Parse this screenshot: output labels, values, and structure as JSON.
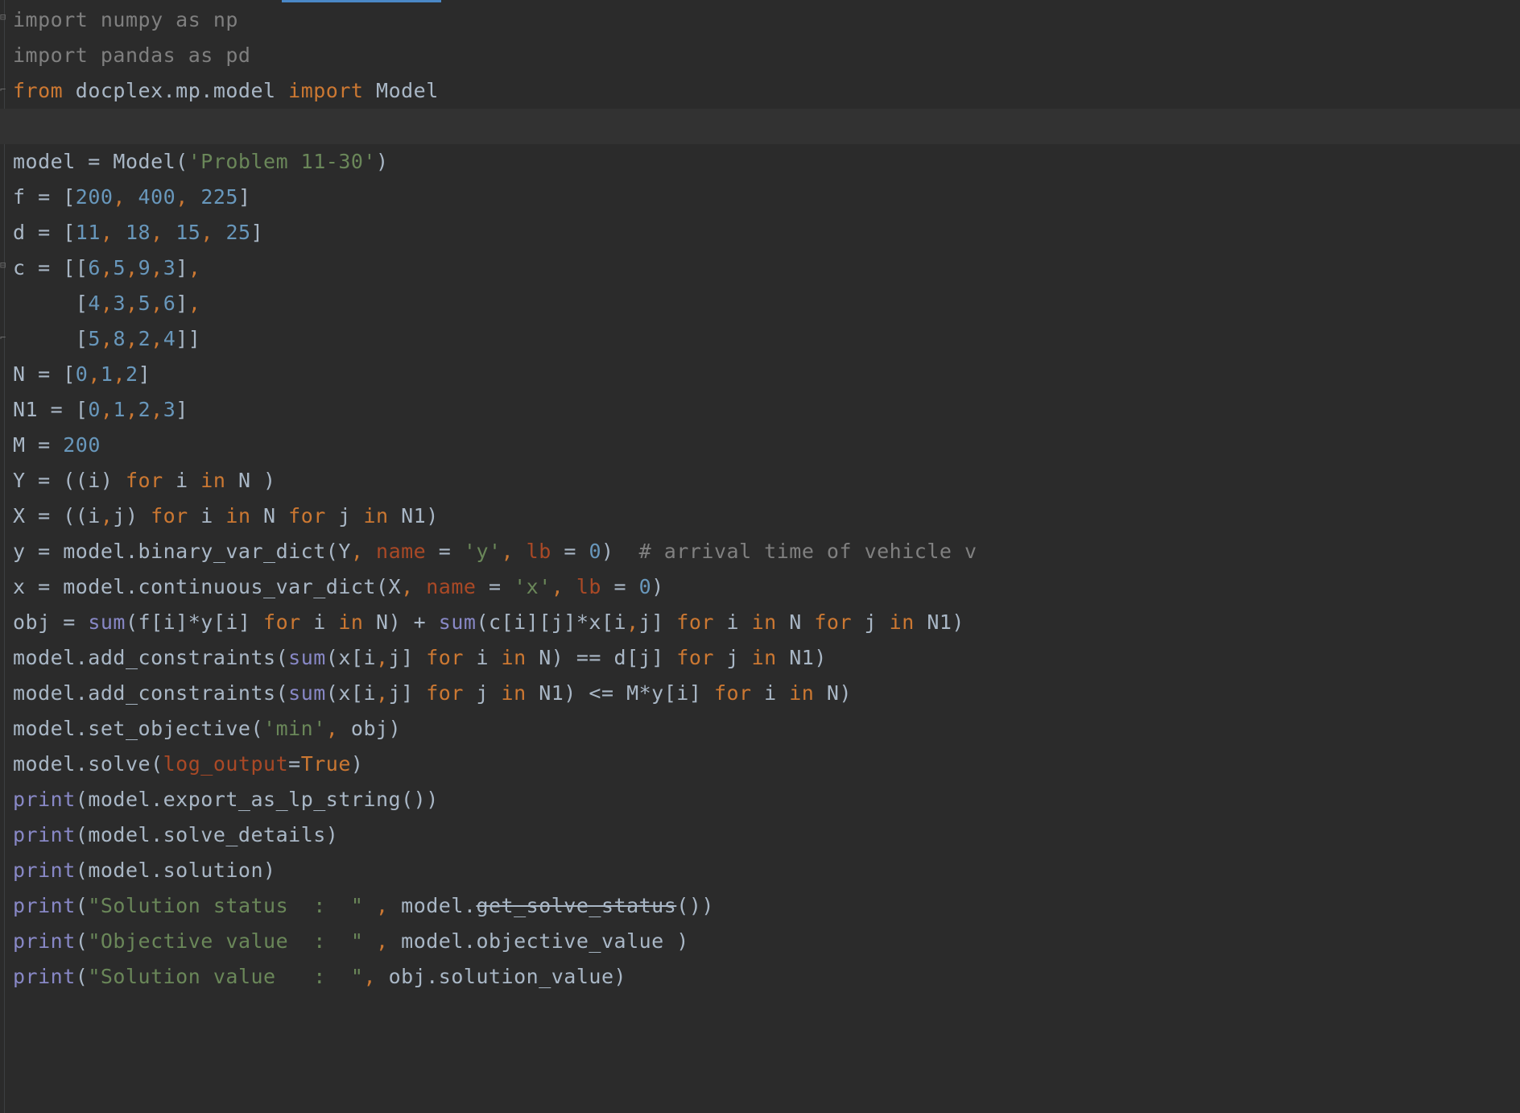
{
  "editor": {
    "colors": {
      "background": "#2b2b2b",
      "keyword": "#cc7832",
      "string": "#6a8759",
      "number": "#6897bb",
      "comment": "#808080",
      "builtin": "#8888c6",
      "parameter": "#aa4926",
      "text": "#a9b7c6",
      "current_line": "#323232"
    },
    "code_lines": [
      "import numpy as np",
      "import pandas as pd",
      "from docplex.mp.model import Model",
      "",
      "model = Model('Problem 11-30')",
      "f = [200, 400, 225]",
      "d = [11, 18, 15, 25]",
      "c = [[6,5,9,3],",
      "     [4,3,5,6],",
      "     [5,8,2,4]]",
      "N = [0,1,2]",
      "N1 = [0,1,2,3]",
      "M = 200",
      "Y = ((i) for i in N )",
      "X = ((i,j) for i in N for j in N1)",
      "y = model.binary_var_dict(Y, name = 'y', lb = 0)  # arrival time of vehicle v",
      "x = model.continuous_var_dict(X, name = 'x', lb = 0)",
      "obj = sum(f[i]*y[i] for i in N) + sum(c[i][j]*x[i,j] for i in N for j in N1)",
      "model.add_constraints(sum(x[i,j] for i in N) == d[j] for j in N1)",
      "model.add_constraints(sum(x[i,j] for j in N1) <= M*y[i] for i in N)",
      "model.set_objective('min', obj)",
      "model.solve(log_output=True)",
      "print(model.export_as_lp_string())",
      "print(model.solve_details)",
      "print(model.solution)",
      "print(\"Solution status  :  \" , model.get_solve_status())",
      "print(\"Objective value  :  \" , model.objective_value )",
      "print(\"Solution value   :  \", obj.solution_value)"
    ]
  }
}
